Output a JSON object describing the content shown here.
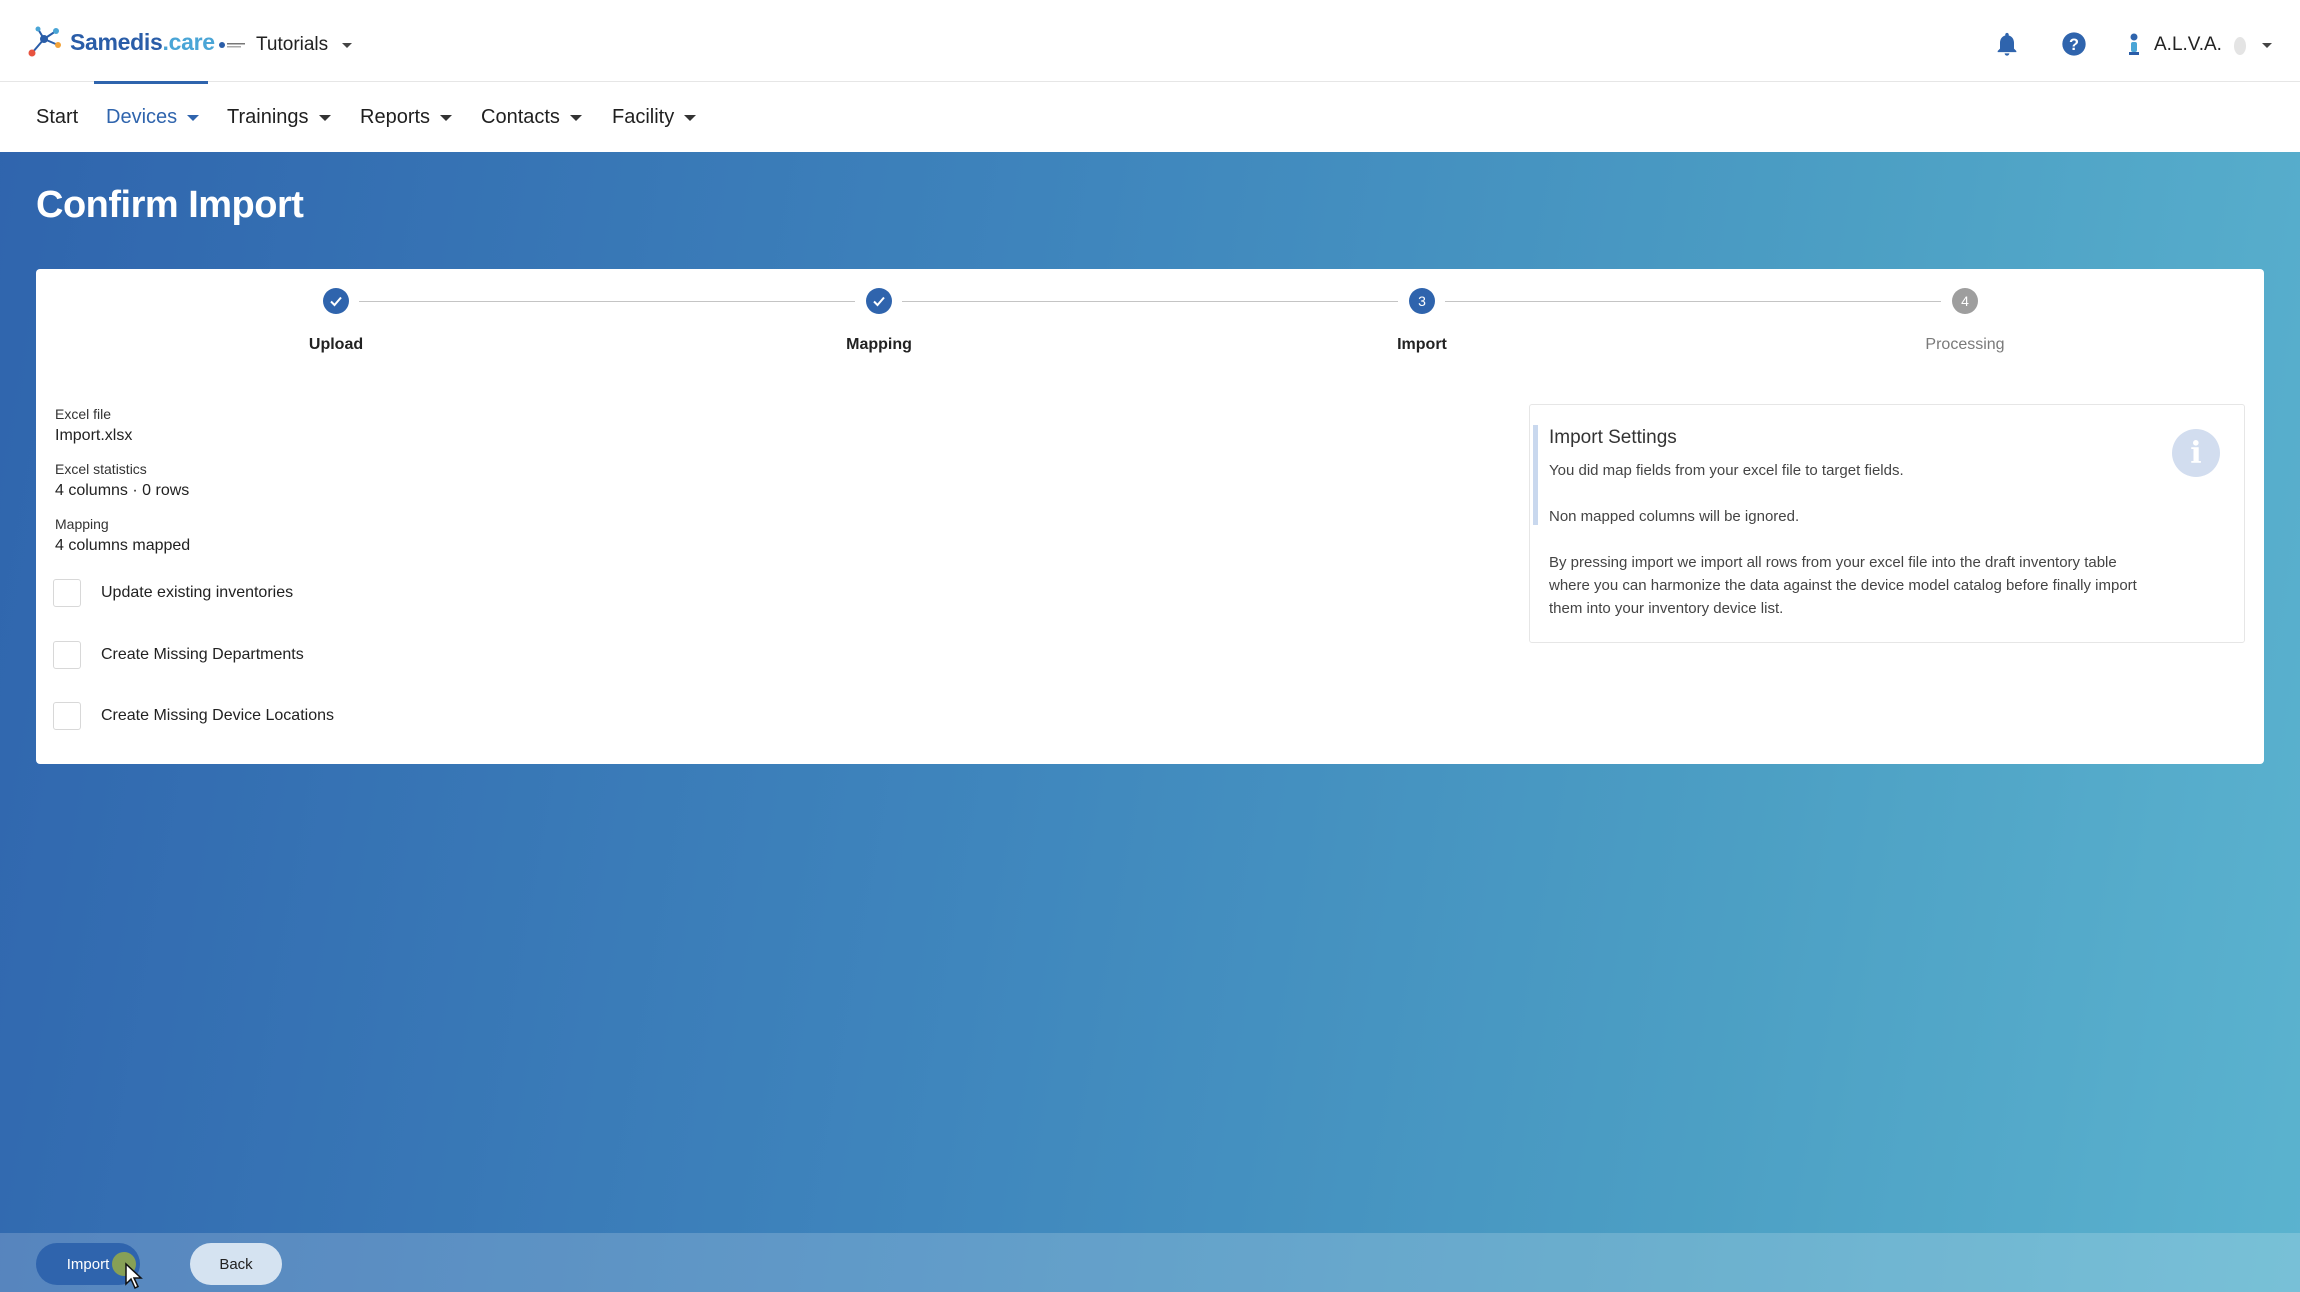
{
  "brand": {
    "name": "Samedis",
    "tld": ".care",
    "blue": "#2a5da8",
    "light_blue": "#4aa5d6"
  },
  "tenant": {
    "name": "Tutorials"
  },
  "header": {
    "user_name": "A.L.V.A.",
    "icons": [
      "bell-icon",
      "help-icon",
      "user-avatar-icon"
    ]
  },
  "nav": {
    "items": [
      {
        "label": "Start",
        "active": false,
        "dropdown": false
      },
      {
        "label": "Devices",
        "active": true,
        "dropdown": true
      },
      {
        "label": "Trainings",
        "active": false,
        "dropdown": true
      },
      {
        "label": "Reports",
        "active": false,
        "dropdown": true
      },
      {
        "label": "Contacts",
        "active": false,
        "dropdown": true
      },
      {
        "label": "Facility",
        "active": false,
        "dropdown": true
      }
    ]
  },
  "page": {
    "title": "Confirm Import"
  },
  "stepper": {
    "steps": [
      {
        "label": "Upload",
        "state": "done",
        "number": "1"
      },
      {
        "label": "Mapping",
        "state": "done",
        "number": "2"
      },
      {
        "label": "Import",
        "state": "current",
        "number": "3"
      },
      {
        "label": "Processing",
        "state": "todo",
        "number": "4"
      }
    ]
  },
  "summary": {
    "excel_file_label": "Excel file",
    "excel_file_value": "Import.xlsx",
    "stats_label": "Excel statistics",
    "stats_value": "4 columns · 0 rows",
    "mapping_label": "Mapping",
    "mapping_value": "4 columns mapped"
  },
  "options": [
    {
      "label": "Update existing inventories",
      "checked": false
    },
    {
      "label": "Create Missing Departments",
      "checked": false
    },
    {
      "label": "Create Missing Device Locations",
      "checked": false
    }
  ],
  "settings": {
    "title": "Import Settings",
    "line1": "You did map fields from your excel file to target fields.",
    "line2": "Non mapped columns will be ignored.",
    "line3": "By pressing import we import all rows from your excel file into the draft inventory table where you can harmonize the data against the device model catalog before finally import them into your inventory device list."
  },
  "actions": {
    "import_label": "Import",
    "back_label": "Back"
  },
  "colors": {
    "primary": "#2f64ad",
    "step_todo": "#9e9e9e",
    "background_start": "#2f64ad",
    "background_end": "#5bb3cf"
  }
}
